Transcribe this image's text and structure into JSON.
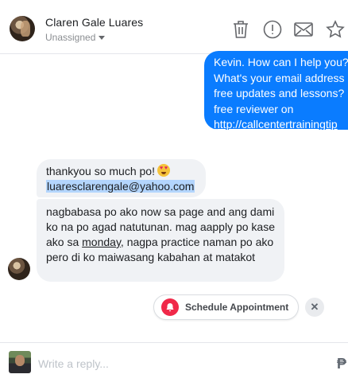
{
  "header": {
    "contact_name": "Claren Gale Luares",
    "assignment": "Unassigned",
    "icons": [
      "trash-icon",
      "alert-icon",
      "mail-icon",
      "star-icon"
    ]
  },
  "messages": {
    "outgoing": {
      "lines": [
        "Kevin. How can I help you?",
        "What's your email address",
        "free updates and lessons?",
        "free reviewer on"
      ],
      "link": "http://callcentertrainingtip"
    },
    "incoming_1": {
      "text": "thankyou so much po!",
      "email": "luaresclarengale@yahoo.com"
    },
    "incoming_2": {
      "text_before": "nagbabasa po ako now sa page and ang dami ko na po agad natutunan. mag aapply po kase ako sa ",
      "underlined": "monday",
      "text_after": ", nagpa practice naman po ako pero di ko maiwasang kabahan at matakot"
    }
  },
  "schedule": {
    "label": "Schedule Appointment",
    "close": "✕"
  },
  "reply": {
    "placeholder": "Write a reply...",
    "payment_glyph": "₱"
  },
  "colors": {
    "outgoing_bubble": "#0a7cff",
    "incoming_bubble": "#f0f2f5",
    "bell": "#f02849"
  }
}
